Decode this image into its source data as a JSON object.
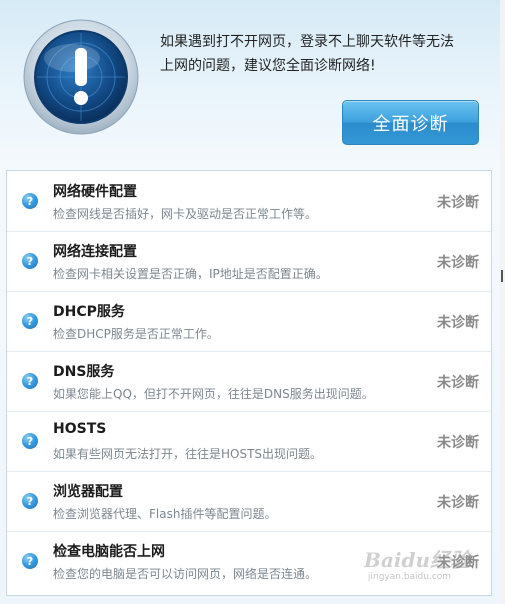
{
  "header": {
    "message_line1": "如果遇到打不开网页，登录不上聊天软件等无法",
    "message_line2": "上网的问题，建议您全面诊断网络!",
    "diagnose_button": "全面诊断",
    "emblem_icon": "exclamation-radar-icon"
  },
  "items": [
    {
      "title": "网络硬件配置",
      "desc": "检查网线是否插好，网卡及驱动是否正常工作等。",
      "status": "未诊断",
      "icon": "question-icon"
    },
    {
      "title": "网络连接配置",
      "desc": "检查网卡相关设置是否正确，IP地址是否配置正确。",
      "status": "未诊断",
      "icon": "question-icon"
    },
    {
      "title": "DHCP服务",
      "desc": "检查DHCP服务是否正常工作。",
      "status": "未诊断",
      "icon": "question-icon"
    },
    {
      "title": "DNS服务",
      "desc": "如果您能上QQ，但打不开网页，往往是DNS服务出现问题。",
      "status": "未诊断",
      "icon": "question-icon"
    },
    {
      "title": "HOSTS",
      "desc": "如果有些网页无法打开，往往是HOSTS出现问题。",
      "status": "未诊断",
      "icon": "question-icon"
    },
    {
      "title": "浏览器配置",
      "desc": "检查浏览器代理、Flash插件等配置问题。",
      "status": "未诊断",
      "icon": "question-icon"
    },
    {
      "title": "检查电脑能否上网",
      "desc": "检查您的电脑是否可以访问网页，网络是否连通。",
      "status": "未诊断",
      "icon": "question-icon"
    }
  ],
  "watermark": {
    "brand": "Baidu经验",
    "url": "jingyan.baidu.com"
  },
  "colors": {
    "accent": "#3a9fdc",
    "status": "#8a8a8a"
  }
}
